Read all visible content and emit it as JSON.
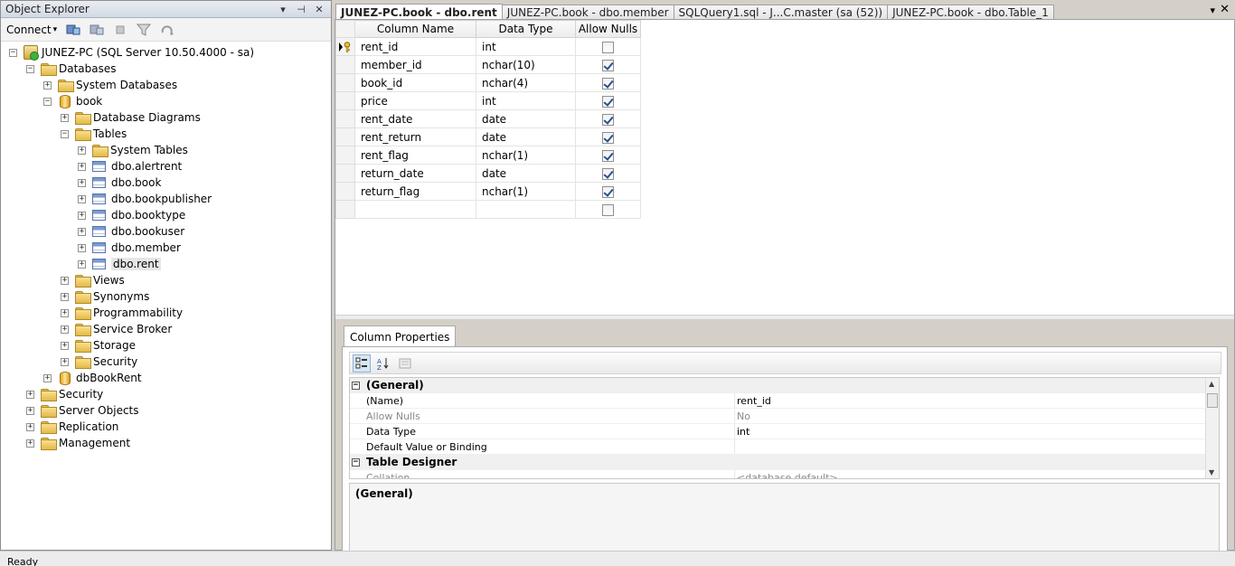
{
  "object_explorer": {
    "title": "Object Explorer",
    "pin_label": "▾",
    "autohide_label": "⊣",
    "close_label": "✕",
    "connect_label": "Connect",
    "connect_arrow": "▾",
    "tree": [
      {
        "label": "JUNEZ-PC (SQL Server 10.50.4000 - sa)",
        "icon": "server-icon",
        "expand": "−"
      },
      {
        "label": "Databases",
        "icon": "folder-icon",
        "expand": "−"
      },
      {
        "label": "System Databases",
        "icon": "folder-icon",
        "expand": "+"
      },
      {
        "label": "book",
        "icon": "database-icon",
        "expand": "−"
      },
      {
        "label": "Database Diagrams",
        "icon": "folder-icon",
        "expand": "+"
      },
      {
        "label": "Tables",
        "icon": "folder-icon",
        "expand": "−"
      },
      {
        "label": "System Tables",
        "icon": "folder-icon",
        "expand": "+"
      },
      {
        "label": "dbo.alertrent",
        "icon": "table-icon",
        "expand": "+"
      },
      {
        "label": "dbo.book",
        "icon": "table-icon",
        "expand": "+"
      },
      {
        "label": "dbo.bookpublisher",
        "icon": "table-icon",
        "expand": "+"
      },
      {
        "label": "dbo.booktype",
        "icon": "table-icon",
        "expand": "+"
      },
      {
        "label": "dbo.bookuser",
        "icon": "table-icon",
        "expand": "+"
      },
      {
        "label": "dbo.member",
        "icon": "table-icon",
        "expand": "+"
      },
      {
        "label": "dbo.rent",
        "icon": "table-icon",
        "expand": "+",
        "selected": true
      },
      {
        "label": "Views",
        "icon": "folder-icon",
        "expand": "+"
      },
      {
        "label": "Synonyms",
        "icon": "folder-icon",
        "expand": "+"
      },
      {
        "label": "Programmability",
        "icon": "folder-icon",
        "expand": "+"
      },
      {
        "label": "Service Broker",
        "icon": "folder-icon",
        "expand": "+"
      },
      {
        "label": "Storage",
        "icon": "folder-icon",
        "expand": "+"
      },
      {
        "label": "Security",
        "icon": "folder-icon",
        "expand": "+"
      },
      {
        "label": "dbBookRent",
        "icon": "database-icon",
        "expand": "+"
      },
      {
        "label": "Security",
        "icon": "folder-icon",
        "expand": "+"
      },
      {
        "label": "Server Objects",
        "icon": "folder-icon",
        "expand": "+"
      },
      {
        "label": "Replication",
        "icon": "folder-icon",
        "expand": "+"
      },
      {
        "label": "Management",
        "icon": "folder-icon",
        "expand": "+"
      }
    ]
  },
  "tabs": [
    {
      "label": "JUNEZ-PC.book - dbo.rent",
      "active": true
    },
    {
      "label": "JUNEZ-PC.book - dbo.member",
      "active": false
    },
    {
      "label": "SQLQuery1.sql - J...C.master (sa (52))",
      "active": false
    },
    {
      "label": "JUNEZ-PC.book - dbo.Table_1",
      "active": false
    }
  ],
  "tab_controls": {
    "dropdown": "▾",
    "close": "✕"
  },
  "designer": {
    "headers": [
      "Column Name",
      "Data Type",
      "Allow Nulls"
    ],
    "rows": [
      {
        "name": "rent_id",
        "type": "int",
        "nulls": false,
        "key": true
      },
      {
        "name": "member_id",
        "type": "nchar(10)",
        "nulls": true
      },
      {
        "name": "book_id",
        "type": "nchar(4)",
        "nulls": true
      },
      {
        "name": "price",
        "type": "int",
        "nulls": true
      },
      {
        "name": "rent_date",
        "type": "date",
        "nulls": true
      },
      {
        "name": "rent_return",
        "type": "date",
        "nulls": true
      },
      {
        "name": "rent_flag",
        "type": "nchar(1)",
        "nulls": true
      },
      {
        "name": "return_date",
        "type": "date",
        "nulls": true
      },
      {
        "name": "return_flag",
        "type": "nchar(1)",
        "nulls": true
      },
      {
        "name": "",
        "type": "",
        "nulls": false
      }
    ]
  },
  "column_properties": {
    "tab_label": "Column Properties",
    "sections": [
      {
        "kind": "cat",
        "label": "(General)"
      },
      {
        "kind": "prop",
        "key": "(Name)",
        "value": "rent_id",
        "gray": false
      },
      {
        "kind": "prop",
        "key": "Allow Nulls",
        "value": "No",
        "gray": true
      },
      {
        "kind": "prop",
        "key": "Data Type",
        "value": "int",
        "gray": false
      },
      {
        "kind": "prop",
        "key": "Default Value or Binding",
        "value": "",
        "gray": false
      },
      {
        "kind": "cat",
        "label": "Table Designer"
      },
      {
        "kind": "prop",
        "key": "Collation",
        "value": "<database default>",
        "gray": true
      }
    ],
    "description": "(General)"
  },
  "status": {
    "text": "Ready"
  }
}
